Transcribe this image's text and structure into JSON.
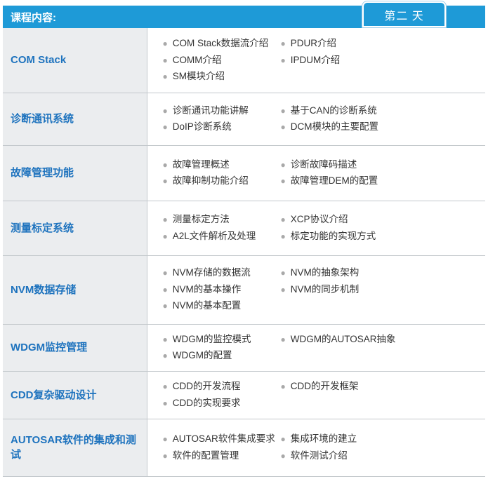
{
  "header": {
    "title": "课程内容:",
    "day_tab": "第二 天"
  },
  "rows": [
    {
      "category": "COM Stack",
      "items": [
        "COM Stack数据流介绍",
        "PDUR介绍",
        "COMM介绍",
        "IPDUM介绍",
        "SM模块介绍"
      ]
    },
    {
      "category": "诊断通讯系统",
      "items": [
        "诊断通讯功能讲解",
        "基于CAN的诊断系统",
        "DoIP诊断系统",
        "DCM模块的主要配置"
      ]
    },
    {
      "category": "故障管理功能",
      "items": [
        "故障管理概述",
        "诊断故障码描述",
        "故障抑制功能介绍",
        "故障管理DEM的配置"
      ]
    },
    {
      "category": "测量标定系统",
      "items": [
        "测量标定方法",
        "XCP协议介绍",
        "A2L文件解析及处理",
        "标定功能的实现方式"
      ]
    },
    {
      "category": "NVM数据存储",
      "items": [
        "NVM存储的数据流",
        "NVM的抽象架构",
        "NVM的基本操作",
        "NVM的同步机制",
        "NVM的基本配置"
      ]
    },
    {
      "category": "WDGM监控管理",
      "items": [
        "WDGM的监控模式",
        "WDGM的AUTOSAR抽象",
        "WDGM的配置"
      ]
    },
    {
      "category": "CDD复杂驱动设计",
      "items": [
        "CDD的开发流程",
        "CDD的开发框架",
        "CDD的实现要求"
      ]
    },
    {
      "category": "AUTOSAR软件的集成和测试",
      "items": [
        "AUTOSAR软件集成要求",
        "集成环境的建立",
        "软件的配置管理",
        "软件测试介绍"
      ]
    }
  ]
}
